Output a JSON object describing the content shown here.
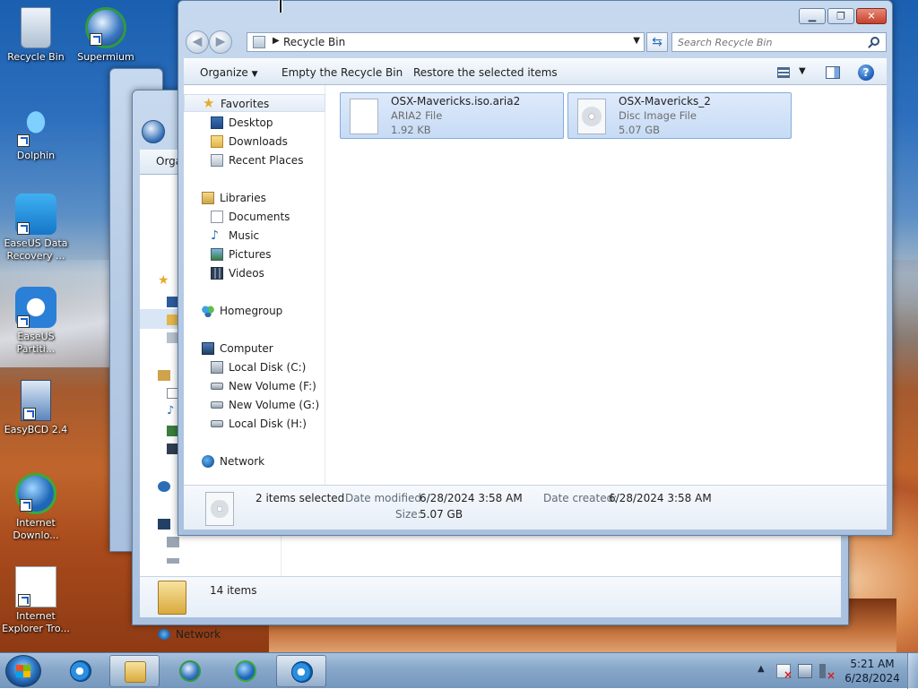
{
  "desktop": {
    "icons": [
      {
        "label": "Recycle Bin",
        "icon": "recycle-bin-icon"
      },
      {
        "label": "Supermium",
        "icon": "supermium-icon"
      },
      {
        "label": "Dolphin",
        "icon": "dolphin-icon"
      },
      {
        "label": "EaseUS Data Recovery ...",
        "icon": "easeus-recovery-icon"
      },
      {
        "label": "EaseUS Partiti...",
        "icon": "easeus-partition-icon"
      },
      {
        "label": "EasyBCD 2.4",
        "icon": "easybcd-icon"
      },
      {
        "label": "Internet Downlo...",
        "icon": "idm-icon"
      },
      {
        "label": "Internet Explorer Tro...",
        "icon": "ie-icon"
      }
    ]
  },
  "bg_window": {
    "toolbar_label": "Orga",
    "network_label": "Network",
    "status_count": "14 items"
  },
  "main_window": {
    "address": {
      "location": "Recycle Bin"
    },
    "search": {
      "placeholder": "Search Recycle Bin"
    },
    "toolbar": {
      "organize": "Organize",
      "empty": "Empty the Recycle Bin",
      "restore": "Restore the selected items"
    },
    "nav": {
      "favorites": "Favorites",
      "desktop": "Desktop",
      "downloads": "Downloads",
      "recent": "Recent Places",
      "libraries": "Libraries",
      "documents": "Documents",
      "music": "Music",
      "pictures": "Pictures",
      "videos": "Videos",
      "homegroup": "Homegroup",
      "computer": "Computer",
      "disk_c": "Local Disk (C:)",
      "vol_f": "New Volume (F:)",
      "vol_g": "New Volume (G:)",
      "disk_h": "Local Disk (H:)",
      "network": "Network"
    },
    "files": [
      {
        "name": "OSX-Mavericks.iso.aria2",
        "type": "ARIA2 File",
        "size": "1.92 KB"
      },
      {
        "name": "OSX-Mavericks_2",
        "type": "Disc Image File",
        "size": "5.07 GB"
      }
    ],
    "details": {
      "selected": "2 items selected",
      "modified_key": "Date modified:",
      "modified_val": "6/28/2024 3:58 AM",
      "created_key": "Date created:",
      "created_val": "6/28/2024 3:58 AM",
      "size_key": "Size:",
      "size_val": "5.07 GB"
    }
  },
  "taskbar": {
    "time": "5:21 AM",
    "date": "6/28/2024"
  }
}
